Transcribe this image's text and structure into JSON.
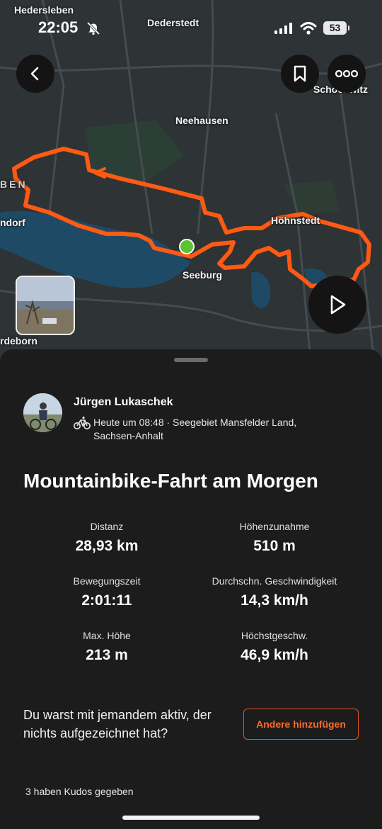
{
  "status_bar": {
    "time": "22:05",
    "battery": "53"
  },
  "map": {
    "places": [
      "Hedersleben",
      "Dederstedt",
      "Neehausen",
      "Schochwitz",
      "BEN",
      "ndorf",
      "Höhnstedt",
      "Seeburg",
      "rdeborn"
    ]
  },
  "activity": {
    "athlete": "Jürgen Lukaschek",
    "meta_line1": "Heute um 08:48 · Seegebiet Mansfelder Land,",
    "meta_line2": "Sachsen-Anhalt",
    "title": "Mountainbike-Fahrt am Morgen",
    "stats": [
      {
        "label": "Distanz",
        "value": "28,93 km"
      },
      {
        "label": "Höhenzunahme",
        "value": "510 m"
      },
      {
        "label": "Bewegungszeit",
        "value": "2:01:11"
      },
      {
        "label": "Durchschn. Geschwindigkeit",
        "value": "14,3 km/h"
      },
      {
        "label": "Max. Höhe",
        "value": "213 m"
      },
      {
        "label": "Höchstgeschw.",
        "value": "46,9 km/h"
      }
    ],
    "question": "Du warst mit jemandem aktiv, der nichts aufgezeichnet hat?",
    "add_button": "Andere hinzufügen",
    "kudos": "3 haben Kudos gegeben"
  },
  "colors": {
    "route": "#ff5a14",
    "accent": "#fc4c02",
    "start_marker": "#5cc233",
    "sheet_bg": "#1c1c1c"
  },
  "icons": [
    "back-icon",
    "bookmark-icon",
    "more-icon",
    "play-icon",
    "bike-icon",
    "bell-off-icon",
    "signal-icon",
    "wifi-icon",
    "battery-icon"
  ]
}
